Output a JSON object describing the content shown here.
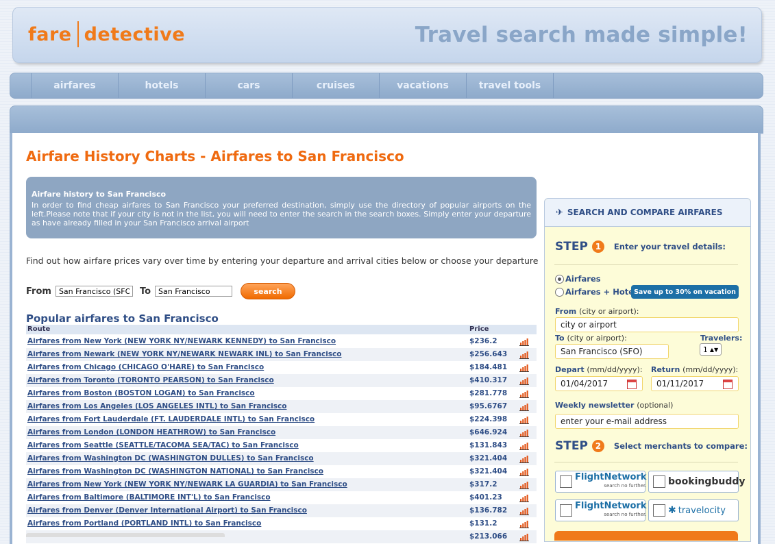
{
  "header": {
    "logo_left": "fare",
    "logo_right": "detective",
    "tagline": "Travel search made simple!"
  },
  "nav": {
    "items": [
      "airfares",
      "hotels",
      "cars",
      "cruises",
      "vacations",
      "travel tools"
    ]
  },
  "main": {
    "title": "Airfare History Charts - Airfares to San Francisco",
    "infobox_title": "Airfare history to San Francisco",
    "infobox_text": "In order to find cheap airfares to San Francisco your preferred destination, simply use the directory of popular airports on the left.Please note that if your city is not in the list, you will need to enter the search in the search boxes. Simply enter your departure as have already filled in your San Francisco arrival airport",
    "find_text": "Find out how airfare prices vary over time by entering your departure and arrival cities below or choose your departure",
    "from_label": "From",
    "from_value": "San Francisco (SFO",
    "to_label": "To",
    "to_value": "San Francisco",
    "search_button": "search",
    "popular_title": "Popular airfares to San Francisco",
    "col_route": "Route",
    "col_price": "Price",
    "rows": [
      {
        "route": "Airfares from New York (NEW YORK NY/NEWARK KENNEDY) to San Francisco",
        "price": "$236.2"
      },
      {
        "route": "Airfares from Newark (NEW YORK NY/NEWARK NEWARK INL) to San Francisco",
        "price": "$256.643"
      },
      {
        "route": "Airfares from Chicago (CHICAGO O'HARE) to San Francisco",
        "price": "$184.481"
      },
      {
        "route": "Airfares from Toronto (TORONTO PEARSON) to San Francisco",
        "price": "$410.317"
      },
      {
        "route": "Airfares from Boston (BOSTON LOGAN) to San Francisco",
        "price": "$281.778"
      },
      {
        "route": "Airfares from Los Angeles (LOS ANGELES INTL) to San Francisco",
        "price": "$95.6767"
      },
      {
        "route": "Airfares from Fort Lauderdale (FT. LAUDERDALE INTL) to San Francisco",
        "price": "$224.398"
      },
      {
        "route": "Airfares from London (LONDON HEATHROW) to San Francisco",
        "price": "$646.924"
      },
      {
        "route": "Airfares from Seattle (SEATTLE/TACOMA SEA/TAC) to San Francisco",
        "price": "$131.843"
      },
      {
        "route": "Airfares from Washington DC (WASHINGTON DULLES) to San Francisco",
        "price": "$321.404"
      },
      {
        "route": "Airfares from Washington DC (WASHINGTON NATIONAL) to San Francisco",
        "price": "$321.404"
      },
      {
        "route": "Airfares from New York (NEW YORK NY/NEWARK LA GUARDIA) to San Francisco",
        "price": "$317.2"
      },
      {
        "route": "Airfares from Baltimore (BALTIMORE INT'L) to San Francisco",
        "price": "$401.23"
      },
      {
        "route": "Airfares from Denver (Denver International Airport) to San Francisco",
        "price": "$136.782"
      },
      {
        "route": "Airfares from Portland (PORTLAND INTL) to San Francisco",
        "price": "$131.2"
      },
      {
        "route": "",
        "price": "$213.066"
      }
    ]
  },
  "panel": {
    "title": "SEARCH AND COMPARE AIRFARES",
    "step_word": "STEP",
    "step1_num": "1",
    "step1_desc": "Enter your travel details:",
    "radio_airfares": "Airfares",
    "radio_airhotel": "Airfares + Hotel",
    "promo": "Save up to 30% on vacation",
    "from_label": "From",
    "from_sub": "(city or airport):",
    "from_value": "city or airport",
    "to_label": "To",
    "to_sub": "(city or airport):",
    "to_value": "San Francisco (SFO)",
    "travelers_label": "Travelers:",
    "travelers_value": "1",
    "depart_label": "Depart",
    "depart_sub": "(mm/dd/yyyy):",
    "depart_value": "01/04/2017",
    "return_label": "Return",
    "return_sub": "(mm/dd/yyyy):",
    "return_value": "01/11/2017",
    "newsletter_label": "Weekly newsletter",
    "newsletter_sub": "(optional)",
    "newsletter_value": "enter your e-mail address",
    "step2_num": "2",
    "step2_desc": "Select merchants to compare:",
    "merchants": {
      "flightnetwork": "FlightNetwork",
      "flightnetwork_tag": "search no further.",
      "bookingbuddy": "bookingbuddy",
      "travelocity": "travelocity"
    }
  },
  "colors": {
    "accent_orange": "#f07a1a",
    "title_orange": "#ef6a10",
    "link_blue": "#2f4e86",
    "nav_blue": "#8eaacb"
  }
}
